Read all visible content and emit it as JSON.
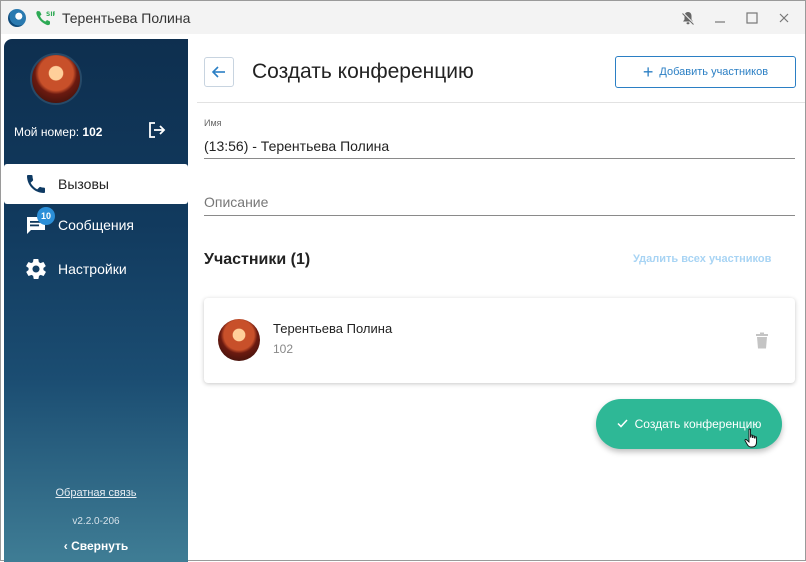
{
  "window": {
    "title": "Терентьева Полина"
  },
  "sidebar": {
    "my_number_label": "Мой номер:",
    "my_number_value": "102",
    "items": [
      {
        "label": "Вызовы",
        "active": true
      },
      {
        "label": "Сообщения",
        "badge": "10"
      },
      {
        "label": "Настройки"
      }
    ],
    "feedback_link": "Обратная связь",
    "version": "v2.2.0-206",
    "collapse_label": "Свернуть"
  },
  "header": {
    "title": "Создать конференцию",
    "add_participants_label": "Добавить участников"
  },
  "form": {
    "name_label": "Имя",
    "name_value": "(13:56) - Терентьева Полина",
    "description_placeholder": "Описание"
  },
  "participants": {
    "title": "Участники (1)",
    "remove_all_label": "Удалить всех участников",
    "list": [
      {
        "name": "Терентьева Полина",
        "number": "102"
      }
    ]
  },
  "actions": {
    "create_label": "Создать конференцию"
  },
  "colors": {
    "accent_blue": "#2b7fc4",
    "create_green": "#2eb896",
    "sidebar_dark": "#0e2f4f",
    "badge_blue": "#2b8fd8"
  }
}
